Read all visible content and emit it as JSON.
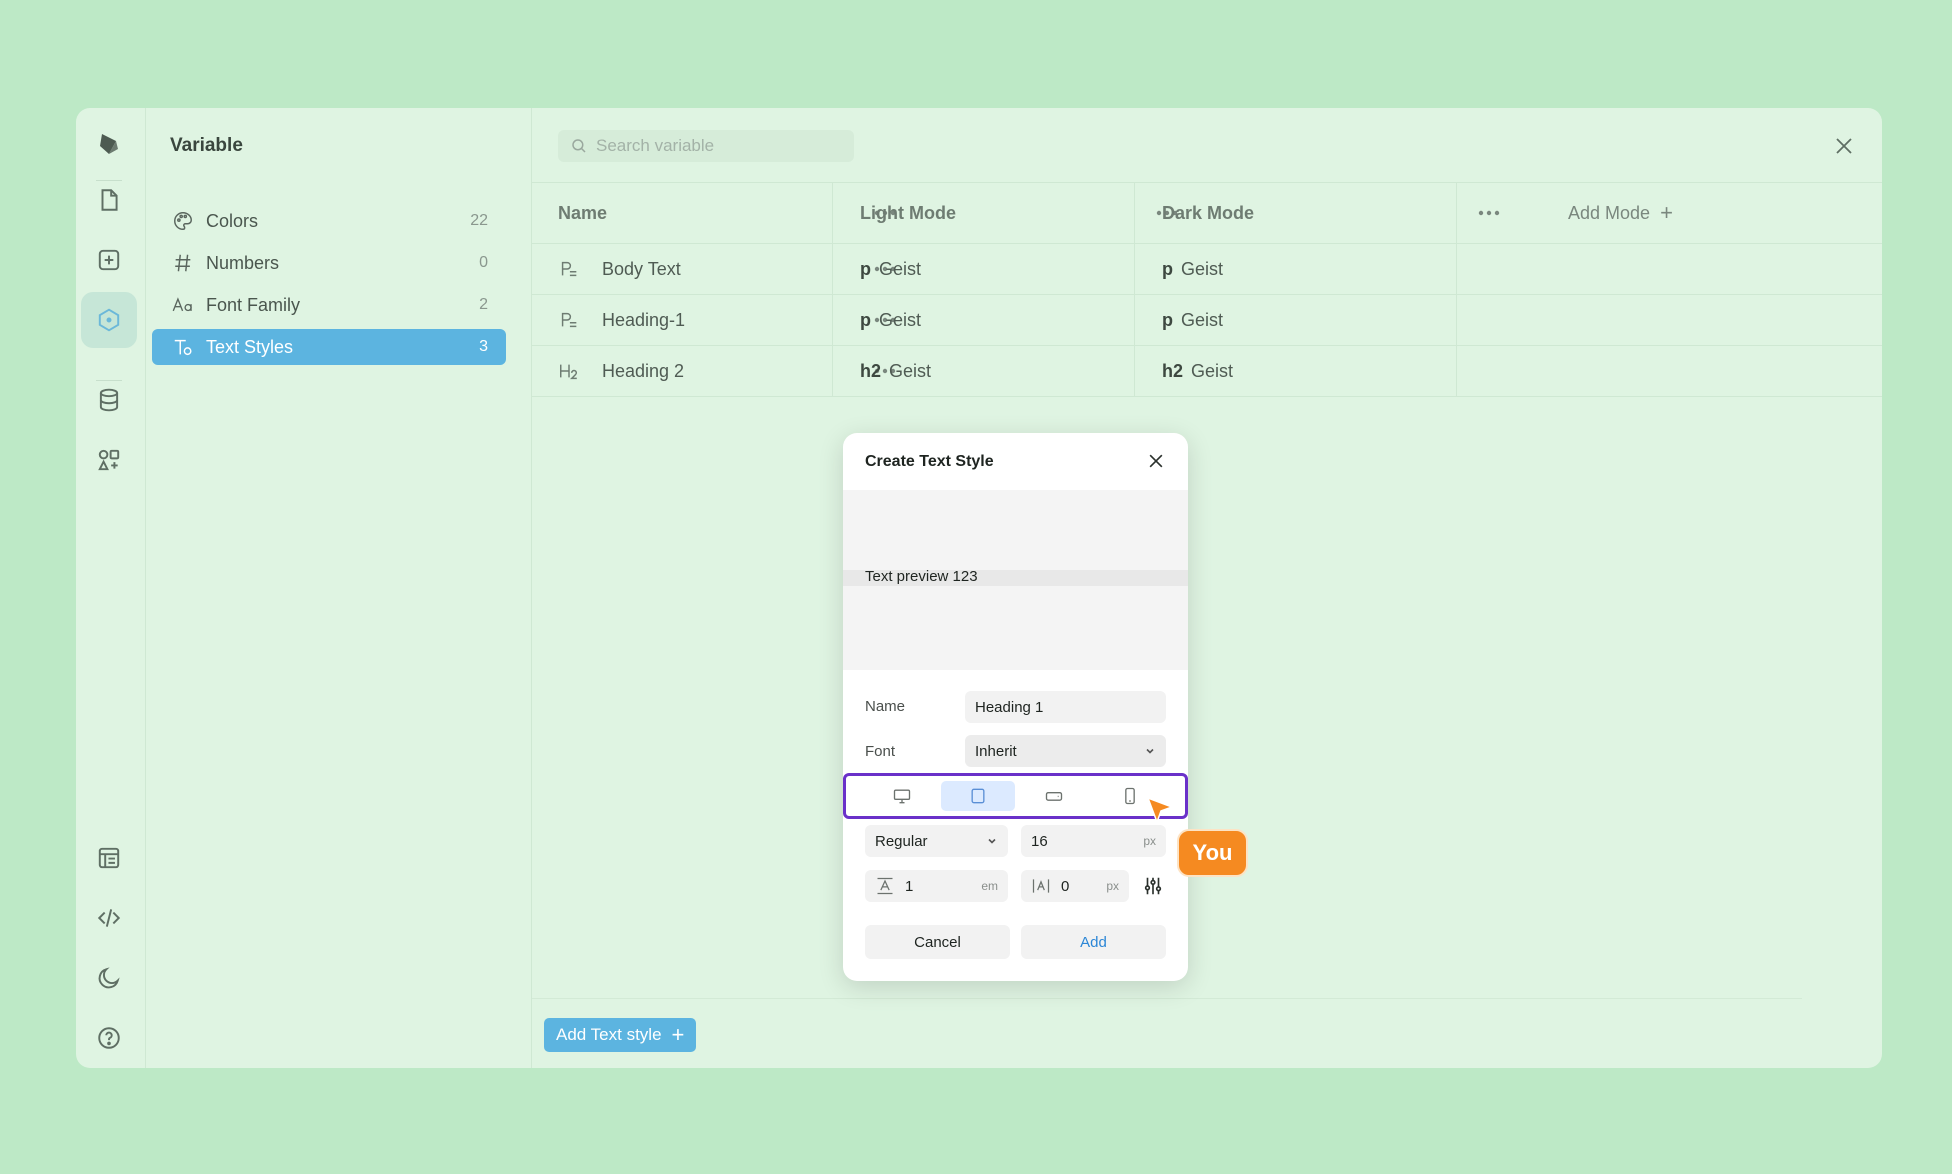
{
  "sidebar": {
    "title": "Variable",
    "items": [
      {
        "label": "Colors",
        "count": "22"
      },
      {
        "label": "Numbers",
        "count": "0"
      },
      {
        "label": "Font Family",
        "count": "2"
      },
      {
        "label": "Text Styles",
        "count": "3"
      }
    ]
  },
  "search": {
    "placeholder": "Search variable"
  },
  "table": {
    "headers": [
      "Name",
      "Light Mode",
      "Dark Mode"
    ],
    "add_mode": "Add Mode",
    "rows": [
      {
        "name": "Body Text",
        "light_tag": "p",
        "light_font": "Geist",
        "dark_tag": "p",
        "dark_font": "Geist"
      },
      {
        "name": "Heading-1",
        "light_tag": "p",
        "light_font": "Geist",
        "dark_tag": "p",
        "dark_font": "Geist"
      },
      {
        "name": "Heading 2",
        "light_tag": "h2",
        "light_font": "Geist",
        "dark_tag": "h2",
        "dark_font": "Geist"
      }
    ]
  },
  "add_text_style": "Add Text style",
  "dialog": {
    "title": "Create Text Style",
    "preview_text": "Text preview 123",
    "name_label": "Name",
    "name_value": "Heading 1",
    "font_label": "Font",
    "font_value": "Inherit",
    "weight_value": "Regular",
    "size_value": "16",
    "size_unit": "px",
    "line_height_value": "1",
    "line_height_unit": "em",
    "letter_spacing_value": "0",
    "letter_spacing_unit": "px",
    "cancel_label": "Cancel",
    "add_label": "Add"
  },
  "cursor": {
    "tag": "You",
    "color": "#f58a21"
  },
  "colors": {
    "accent": "#5cb4e0",
    "highlight_border": "#6a31c9",
    "background": "#bde9c6"
  }
}
